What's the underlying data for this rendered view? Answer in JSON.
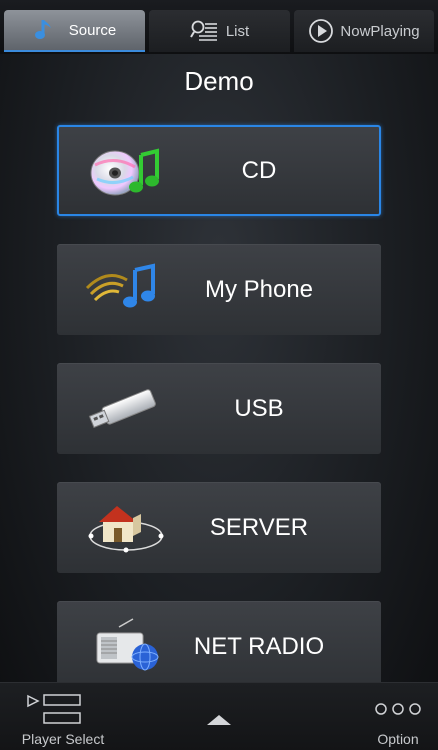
{
  "tabs": [
    {
      "label": "Source",
      "icon": "music-note-icon",
      "active": true
    },
    {
      "label": "List",
      "icon": "search-list-icon",
      "active": false
    },
    {
      "label": "NowPlaying",
      "icon": "play-circle-icon",
      "active": false
    }
  ],
  "page_title": "Demo",
  "sources": [
    {
      "label": "CD",
      "icon": "cd-music-icon",
      "selected": true
    },
    {
      "label": "My Phone",
      "icon": "phone-music-icon",
      "selected": false
    },
    {
      "label": "USB",
      "icon": "usb-drive-icon",
      "selected": false
    },
    {
      "label": "SERVER",
      "icon": "home-network-icon",
      "selected": false
    },
    {
      "label": "NET RADIO",
      "icon": "radio-globe-icon",
      "selected": false
    }
  ],
  "bottom_bar": {
    "player_select_label": "Player Select",
    "option_label": "Option"
  },
  "colors": {
    "accent": "#2a86e6",
    "active_tab_underline": "#3b8bdc"
  }
}
